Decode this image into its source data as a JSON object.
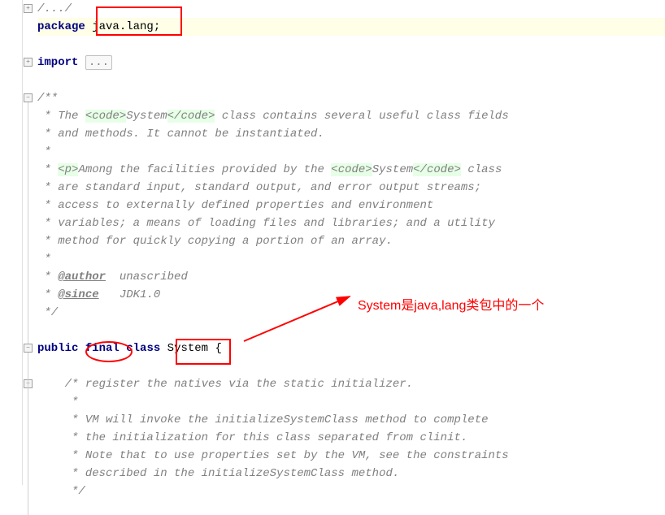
{
  "code": {
    "fold1": "/.../",
    "pkg_kw": "package",
    "pkg_name": " java.lang;",
    "import_kw": "import",
    "import_fold": "...",
    "doc_start": "/**",
    "doc1a": " * The ",
    "doc1_c1": "<code>",
    "doc1_mid": "System",
    "doc1_c2": "</code>",
    "doc1b": " class contains several useful class fields",
    "doc2": " * and methods. It cannot be instantiated.",
    "doc3": " *",
    "doc4a": " * ",
    "doc4_p": "<p>",
    "doc4b": "Among the facilities provided by the ",
    "doc4_c1": "<code>",
    "doc4_mid": "System",
    "doc4_c2": "</code>",
    "doc4c": " class",
    "doc5": " * are standard input, standard output, and error output streams;",
    "doc6": " * access to externally defined properties and environment",
    "doc7": " * variables; a means of loading files and libraries; and a utility",
    "doc8": " * method for quickly copying a portion of an array.",
    "doc9": " *",
    "doc10a": " * ",
    "doc10_tag": "@author",
    "doc10b": "  unascribed",
    "doc11a": " * ",
    "doc11_tag": "@since",
    "doc11b": "   JDK1.0",
    "doc_end": " */",
    "cls_public": "public",
    "cls_final": "final",
    "cls_class": "class",
    "cls_name": "System",
    "cls_brace": " {",
    "c1": "/* register the natives via the static initializer.",
    "c2": " *",
    "c3": " * VM will invoke the initializeSystemClass method to complete",
    "c4": " * the initialization for this class separated from clinit.",
    "c5": " * Note that to use properties set by the VM, see the constraints",
    "c6": " * described in the initializeSystemClass method.",
    "c7": " */"
  },
  "annotation": {
    "text": "System是java,lang类包中的一个"
  }
}
